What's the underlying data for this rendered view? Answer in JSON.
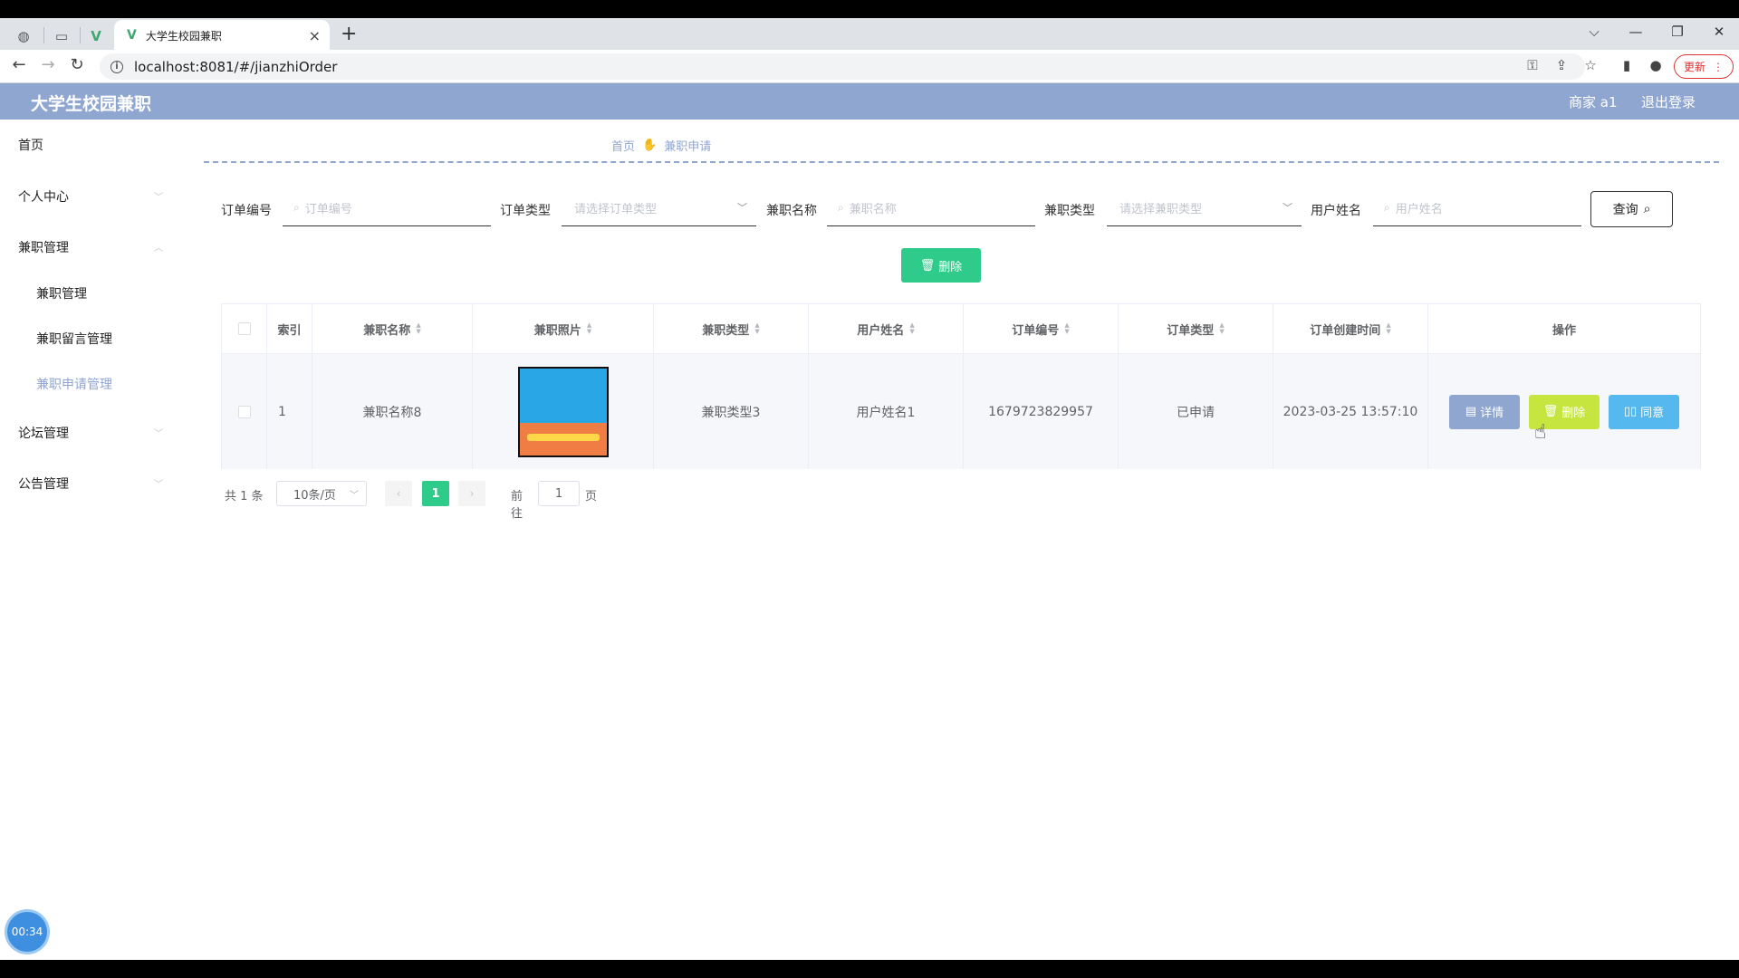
{
  "browser": {
    "tab_title": "大学生校园兼职",
    "new_tab": "+",
    "url": "localhost:8081/#/jianzhiOrder",
    "update_label": "更新"
  },
  "header": {
    "title": "大学生校园兼职",
    "user": "商家 a1",
    "logout": "退出登录"
  },
  "sidebar": {
    "items": [
      {
        "label": "首页"
      },
      {
        "label": "个人中心"
      },
      {
        "label": "兼职管理"
      },
      {
        "label": "论坛管理"
      },
      {
        "label": "公告管理"
      }
    ],
    "sub_items": [
      {
        "label": "兼职管理"
      },
      {
        "label": "兼职留言管理"
      },
      {
        "label": "兼职申请管理"
      }
    ]
  },
  "breadcrumb": {
    "home": "首页",
    "current": "兼职申请"
  },
  "filters": {
    "order_no_label": "订单编号",
    "order_no_placeholder": "订单编号",
    "order_type_label": "订单类型",
    "order_type_placeholder": "请选择订单类型",
    "job_name_label": "兼职名称",
    "job_name_placeholder": "兼职名称",
    "job_type_label": "兼职类型",
    "job_type_placeholder": "请选择兼职类型",
    "user_name_label": "用户姓名",
    "user_name_placeholder": "用户姓名",
    "query_label": "查询"
  },
  "actions": {
    "delete_label": "删除"
  },
  "table": {
    "columns": [
      "索引",
      "兼职名称",
      "兼职照片",
      "兼职类型",
      "用户姓名",
      "订单编号",
      "订单类型",
      "订单创建时间",
      "操作"
    ],
    "rows": [
      {
        "index": "1",
        "job_name": "兼职名称8",
        "job_type": "兼职类型3",
        "user_name": "用户姓名1",
        "order_no": "1679723829957",
        "order_type": "已申请",
        "created": "2023-03-25 13:57:10",
        "detail_label": "详情",
        "delete_label": "删除",
        "agree_label": "同意"
      }
    ]
  },
  "pagination": {
    "total": "共 1 条",
    "page_size": "10条/页",
    "current_page": "1",
    "goto_label": "前往",
    "goto_value": "1",
    "page_suffix": "页"
  },
  "timer": "00:34",
  "colors": {
    "primary": "#8fa6d1",
    "success": "#2fcb8a",
    "warning": "#c6e63f",
    "info": "#55b8ee"
  }
}
